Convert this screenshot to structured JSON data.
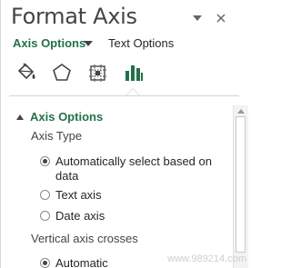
{
  "pane": {
    "title": "Format Axis"
  },
  "header_icons": {
    "dropdown": "chevron-down-icon",
    "close": "close-icon"
  },
  "subtabs": {
    "active_label": "Axis Options",
    "other_label": "Text Options"
  },
  "icon_tabs": [
    {
      "name": "fill-line-icon",
      "selected": false
    },
    {
      "name": "effects-pentagon-icon",
      "selected": false
    },
    {
      "name": "size-properties-icon",
      "selected": false
    },
    {
      "name": "axis-options-bar-chart-icon",
      "selected": true
    }
  ],
  "section": {
    "title": "Axis Options",
    "axis_type_label": "Axis Type",
    "axis_type_options": [
      {
        "label": "Automatically select based on data",
        "checked": true
      },
      {
        "label": "Text axis",
        "checked": false
      },
      {
        "label": "Date axis",
        "checked": false
      }
    ],
    "vertical_crosses_label": "Vertical axis crosses",
    "vertical_crosses_options": [
      {
        "label": "Automatic",
        "checked": true
      }
    ]
  },
  "watermark": "www.989214.com",
  "colors": {
    "accent": "#217346",
    "text": "#262626",
    "title": "#444444"
  }
}
